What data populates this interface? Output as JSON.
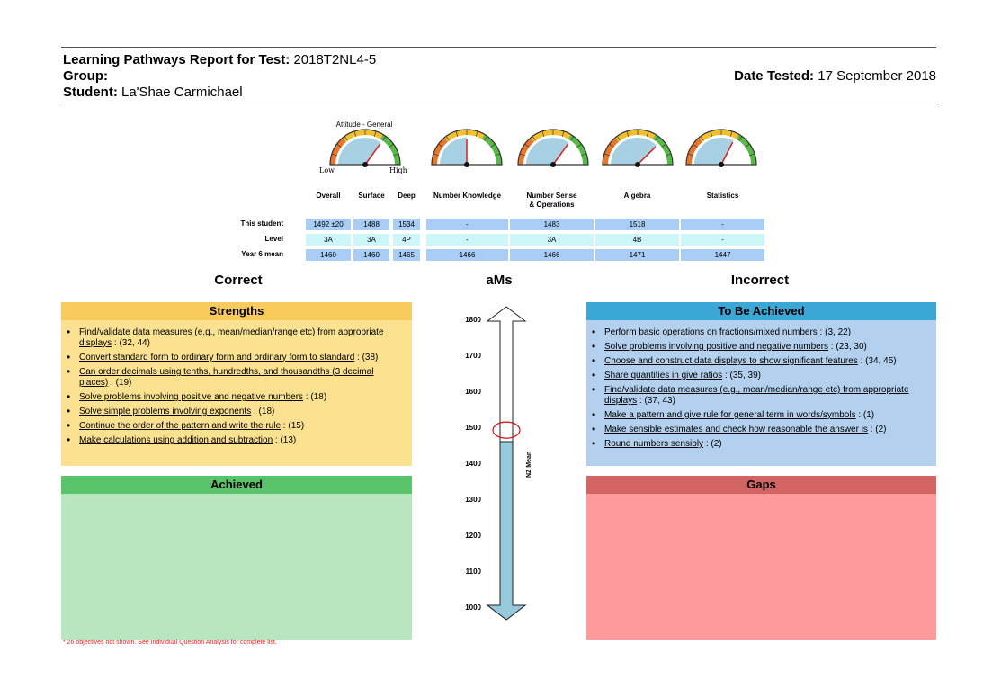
{
  "header": {
    "title_label": "Learning Pathways Report for Test:",
    "title_value": "2018T2NL4-5",
    "group_label": "Group:",
    "group_value": "",
    "student_label": "Student:",
    "student_value": "La'Shae Carmichael",
    "date_label": "Date Tested:",
    "date_value": "17 September 2018"
  },
  "gauges": {
    "attitude_label": "Attitude - General",
    "low_label": "Low",
    "high_label": "High",
    "levels": [
      0.7,
      0.5,
      0.7,
      0.75,
      0.65
    ]
  },
  "table": {
    "columns": [
      "Overall",
      "Surface",
      "Deep",
      "Number Knowledge",
      "Number Sense\n& Operations",
      "Algebra",
      "Statistics"
    ],
    "rows": [
      {
        "label": "This student",
        "values": [
          "1492 ±20",
          "1488",
          "1534",
          "-",
          "1483",
          "1518",
          "-"
        ]
      },
      {
        "label": "Level",
        "values": [
          "3A",
          "3A",
          "4P",
          "-",
          "3A",
          "4B",
          "-"
        ]
      },
      {
        "label": "Year 6 mean",
        "values": [
          "1460",
          "1460",
          "1465",
          "1466",
          "1466",
          "1471",
          "1447"
        ]
      }
    ]
  },
  "sections": {
    "correct": "Correct",
    "ams": "aMs",
    "incorrect": "Incorrect"
  },
  "strengths": {
    "title": "Strengths",
    "items": [
      {
        "link": "Find/validate data measures (e.g., mean/median/range etc) from appropriate displays",
        "tail": " : (32, 44)"
      },
      {
        "link": "Convert standard form to ordinary form and ordinary form to standard",
        "tail": " : (38)"
      },
      {
        "link": "Can order decimals using tenths, hundredths, and thousandths (3 decimal places)",
        "tail": " : (19)"
      },
      {
        "link": "Solve problems involving positive and negative numbers",
        "tail": " : (18)"
      },
      {
        "link": "Solve simple problems involving exponents",
        "tail": " : (18)"
      },
      {
        "link": "Continue the order of the pattern and write the rule",
        "tail": " : (15)"
      },
      {
        "link": "Make calculations using addition and subtraction",
        "tail": " : (13)"
      }
    ]
  },
  "achieved": {
    "title": "Achieved"
  },
  "to_be_achieved": {
    "title": "To Be Achieved",
    "items": [
      {
        "link": "Perform basic operations on fractions/mixed numbers",
        "tail": " : (3, 22)"
      },
      {
        "link": "Solve problems involving positive and negative numbers",
        "tail": " : (23, 30)"
      },
      {
        "link": "Choose and construct data displays to show significant features",
        "tail": " : (34, 45)"
      },
      {
        "link": "Share quantities in give ratios",
        "tail": " : (35, 39)"
      },
      {
        "link": "Find/validate data measures (e.g., mean/median/range etc) from appropriate displays",
        "tail": " : (37, 43)"
      },
      {
        "link": "Make a pattern and give rule for general term in words/symbols",
        "tail": " : (1)"
      },
      {
        "link": "Make sensible estimates and check how reasonable the answer is",
        "tail": " : (2)"
      },
      {
        "link": "Round numbers sensibly",
        "tail": " : (2)"
      }
    ]
  },
  "gaps": {
    "title": "Gaps"
  },
  "scale": {
    "ticks": [
      "1800",
      "1700",
      "1600",
      "1500",
      "1400",
      "1300",
      "1200",
      "1100",
      "1000"
    ],
    "nz_mean_label": "NZ Mean",
    "student_score": 1492,
    "nz_mean": 1460,
    "min": 1000,
    "max": 1800
  },
  "footnote": "* 26 objectives not shown. See Individual Question Analysis for complete list.",
  "colors": {
    "strengths": "#f9cb5c",
    "strengths_body": "#fbe190",
    "achieved": "#59c46a",
    "achieved_body": "#b8e6bf",
    "tba": "#3aa7d6",
    "tba_body": "#b3d0ef",
    "gaps": "#d26564",
    "gaps_body": "#fd9b9b"
  }
}
